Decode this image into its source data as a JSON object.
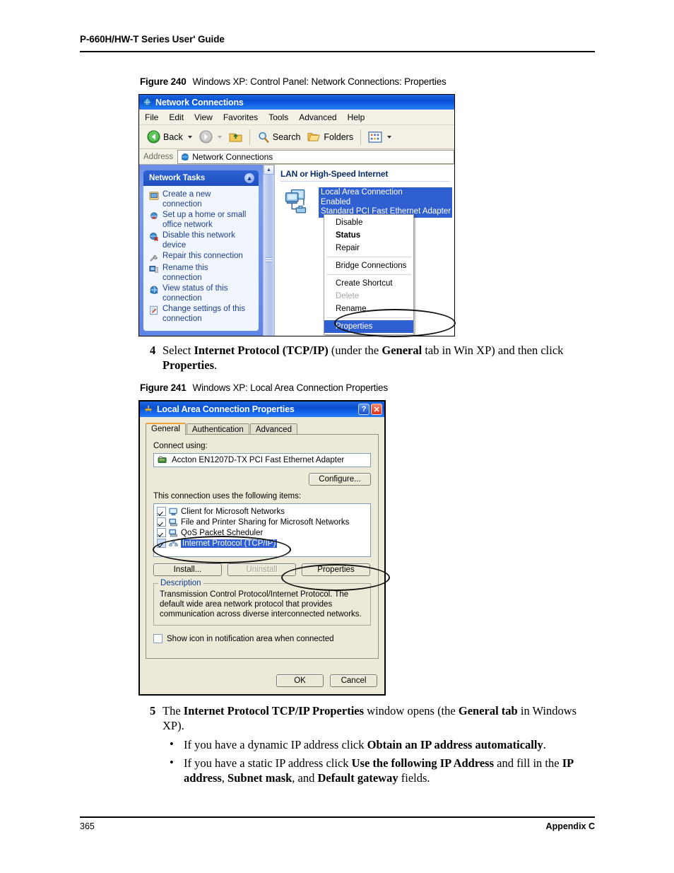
{
  "page": {
    "header": "P-660H/HW-T Series User' Guide",
    "footer_left": "365",
    "footer_right": "Appendix C"
  },
  "figures": {
    "fig240": {
      "number": "Figure 240",
      "caption": "Windows XP: Control Panel: Network Connections: Properties"
    },
    "fig241": {
      "number": "Figure 241",
      "caption": "Windows XP: Local Area Connection Properties"
    }
  },
  "steps": {
    "step4": {
      "number": "4",
      "parts": [
        {
          "t": "Select ",
          "b": false
        },
        {
          "t": "Internet Protocol (TCP/IP)",
          "b": true
        },
        {
          "t": " (under the ",
          "b": false
        },
        {
          "t": "General",
          "b": true
        },
        {
          "t": " tab in Win XP) and then click ",
          "b": false
        },
        {
          "t": "Properties",
          "b": true
        },
        {
          "t": ".",
          "b": false
        }
      ]
    },
    "step5": {
      "number": "5",
      "parts": [
        {
          "t": "The ",
          "b": false
        },
        {
          "t": "Internet Protocol TCP/IP Properties",
          "b": true
        },
        {
          "t": " window opens (the ",
          "b": false
        },
        {
          "t": "General tab",
          "b": true
        },
        {
          "t": " in Windows XP).",
          "b": false
        }
      ]
    },
    "bullet1": {
      "marker": "•",
      "parts": [
        {
          "t": "If you have a dynamic IP address click ",
          "b": false
        },
        {
          "t": "Obtain an IP address automatically",
          "b": true
        },
        {
          "t": ".",
          "b": false
        }
      ]
    },
    "bullet2": {
      "marker": "•",
      "parts": [
        {
          "t": "If you have a static IP address click ",
          "b": false
        },
        {
          "t": "Use the following IP Address",
          "b": true
        },
        {
          "t": " and fill in the ",
          "b": false
        },
        {
          "t": "IP address",
          "b": true
        },
        {
          "t": ", ",
          "b": false
        },
        {
          "t": "Subnet mask",
          "b": true
        },
        {
          "t": ", and ",
          "b": false
        },
        {
          "t": "Default gateway",
          "b": true
        },
        {
          "t": " fields.",
          "b": false
        }
      ]
    }
  },
  "network_connections_window": {
    "title": "Network Connections",
    "menu": [
      "File",
      "Edit",
      "View",
      "Favorites",
      "Tools",
      "Advanced",
      "Help"
    ],
    "toolbar": {
      "back": "Back",
      "search": "Search",
      "folders": "Folders"
    },
    "address": {
      "label": "Address",
      "value": "Network Connections"
    },
    "sidebar": {
      "title": "Network Tasks",
      "items": [
        "Create a new connection",
        "Set up a home or small office network",
        "Disable this network device",
        "Repair this connection",
        "Rename this connection",
        "View status of this connection",
        "Change settings of this connection"
      ]
    },
    "content": {
      "group_title": "LAN or High-Speed Internet",
      "connection": {
        "name": "Local Area Connection",
        "status": "Enabled",
        "adapter": "Standard PCI Fast Ethernet Adapter"
      }
    },
    "context_menu": [
      {
        "label": "Disable",
        "state": "normal"
      },
      {
        "label": "Status",
        "state": "bold"
      },
      {
        "label": "Repair",
        "state": "normal"
      },
      {
        "label": "---",
        "state": "separator"
      },
      {
        "label": "Bridge Connections",
        "state": "normal"
      },
      {
        "label": "---",
        "state": "separator"
      },
      {
        "label": "Create Shortcut",
        "state": "normal"
      },
      {
        "label": "Delete",
        "state": "disabled"
      },
      {
        "label": "Rename",
        "state": "normal"
      },
      {
        "label": "---",
        "state": "separator"
      },
      {
        "label": "Properties",
        "state": "selected"
      }
    ]
  },
  "lac_properties_dialog": {
    "title": "Local Area Connection Properties",
    "titlebar_buttons": {
      "help": "?",
      "close": "✕"
    },
    "tabs": [
      {
        "label": "General",
        "active": true
      },
      {
        "label": "Authentication",
        "active": false
      },
      {
        "label": "Advanced",
        "active": false
      }
    ],
    "connect_using_label": "Connect using:",
    "adapter": "Accton EN1207D-TX PCI Fast Ethernet Adapter",
    "configure_button": "Configure...",
    "items_label": "This connection uses the following items:",
    "items": [
      {
        "label": "Client for Microsoft Networks",
        "checked": true,
        "selected": false
      },
      {
        "label": "File and Printer Sharing for Microsoft Networks",
        "checked": true,
        "selected": false
      },
      {
        "label": "QoS Packet Scheduler",
        "checked": true,
        "selected": false
      },
      {
        "label": "Internet Protocol (TCP/IP)",
        "checked": true,
        "selected": true
      }
    ],
    "buttons": {
      "install": "Install...",
      "uninstall": "Uninstall",
      "properties": "Properties"
    },
    "description": {
      "legend": "Description",
      "text": "Transmission Control Protocol/Internet Protocol. The default wide area network protocol that provides communication across diverse interconnected networks."
    },
    "show_icon_checkbox": {
      "label": "Show icon in notification area when connected",
      "checked": false
    },
    "footer": {
      "ok": "OK",
      "cancel": "Cancel"
    }
  },
  "colors": {
    "titlebar_blue": "#0a4fd0",
    "selection_blue": "#2f5fd0",
    "dialog_face": "#ece9d8",
    "sidebar_blue": "#6b8de8",
    "link_blue": "#1a3f8f"
  }
}
